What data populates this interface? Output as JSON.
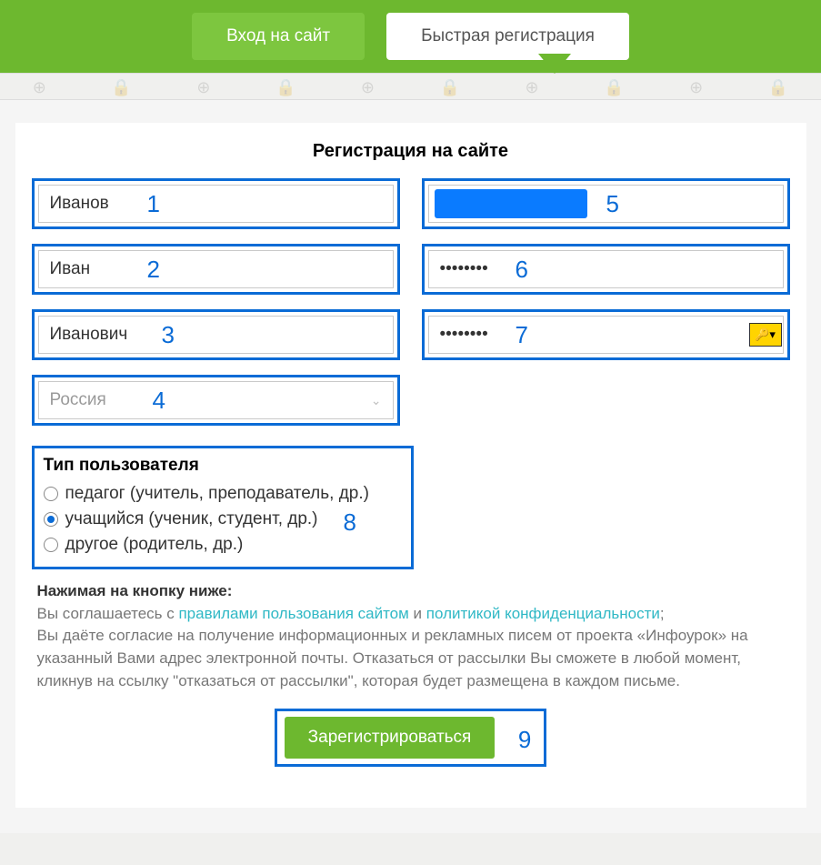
{
  "tabs": {
    "login": "Вход на сайт",
    "register": "Быстрая регистрация"
  },
  "heading": "Регистрация на сайте",
  "fields": {
    "lastname": {
      "value": "Иванов",
      "num": "1"
    },
    "firstname": {
      "value": "Иван",
      "num": "2"
    },
    "patronymic": {
      "value": "Иванович",
      "num": "3"
    },
    "country": {
      "value": "Россия",
      "num": "4"
    },
    "email": {
      "num": "5"
    },
    "password": {
      "value": "••••••••",
      "num": "6"
    },
    "password2": {
      "value": "••••••••",
      "num": "7"
    }
  },
  "usertype": {
    "title": "Тип пользователя",
    "num": "8",
    "options": [
      {
        "label": "педагог (учитель, преподаватель, др.)",
        "selected": false
      },
      {
        "label": "учащийся (ученик, студент, др.)",
        "selected": true
      },
      {
        "label": "другое (родитель, др.)",
        "selected": false
      }
    ]
  },
  "legal": {
    "boldline": "Нажимая на кнопку ниже:",
    "line1a": "Вы соглашаетесь с ",
    "link1": "правилами пользования сайтом",
    "line1b": " и ",
    "link2": "политикой конфиденциальности",
    "line1c": ";",
    "line2": "Вы даёте согласие на получение информационных и рекламных писем от проекта «Инфоурок» на указанный Вами адрес электронной почты. Отказаться от рассылки Вы сможете в любой момент, кликнув на ссылку \"отказаться от рассылки\", которая будет размещена в каждом письме."
  },
  "submit": {
    "label": "Зарегистрироваться",
    "num": "9"
  },
  "icons": {
    "key": "🔑▾"
  }
}
